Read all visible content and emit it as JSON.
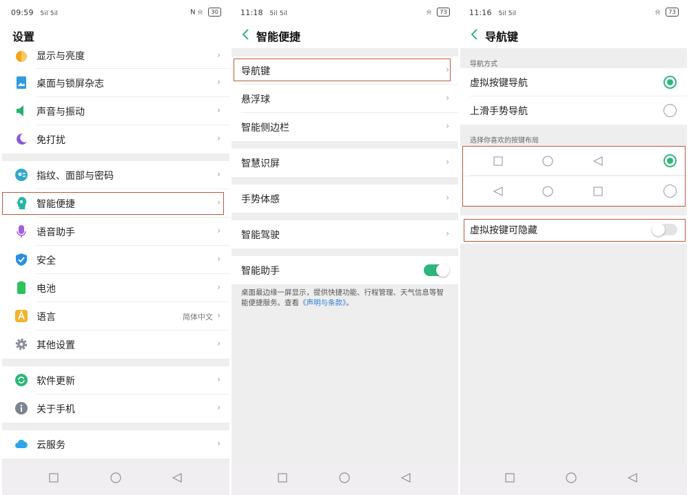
{
  "colors": {
    "accent": "#2eb67d",
    "highlight": "#c0553c",
    "link": "#2b7fd6"
  },
  "panel1": {
    "status": {
      "time": "09:59",
      "signal": "5il 5il",
      "right_icons": "N ⍾",
      "battery": "30"
    },
    "title": "设置",
    "items": [
      {
        "label": "显示与亮度",
        "icon": "brightness-icon"
      },
      {
        "label": "桌面与锁屏杂志",
        "icon": "wallpaper-icon"
      },
      {
        "label": "声音与振动",
        "icon": "sound-icon"
      },
      {
        "label": "免打扰",
        "icon": "moon-icon"
      },
      {
        "label": "指纹、面部与密码",
        "icon": "fingerprint-icon"
      },
      {
        "label": "智能便捷",
        "icon": "smart-assist-icon"
      },
      {
        "label": "语音助手",
        "icon": "microphone-icon"
      },
      {
        "label": "安全",
        "icon": "shield-icon"
      },
      {
        "label": "电池",
        "icon": "battery-icon"
      },
      {
        "label": "语言",
        "icon": "language-icon",
        "value": "简体中文"
      },
      {
        "label": "其他设置",
        "icon": "gear-icon"
      },
      {
        "label": "软件更新",
        "icon": "update-icon"
      },
      {
        "label": "关于手机",
        "icon": "info-icon"
      },
      {
        "label": "云服务",
        "icon": "cloud-icon"
      }
    ]
  },
  "panel2": {
    "status": {
      "time": "11:18",
      "signal": "5il 5il",
      "battery": "73"
    },
    "title": "智能便捷",
    "items": [
      {
        "label": "导航键"
      },
      {
        "label": "悬浮球"
      },
      {
        "label": "智能侧边栏"
      },
      {
        "label": "智慧识屏"
      },
      {
        "label": "手势体感"
      },
      {
        "label": "智能驾驶"
      },
      {
        "label": "智能助手",
        "toggle": "on"
      }
    ],
    "footnote_text": "桌面最边缘一屏显示，提供快捷功能、行程管理、天气信息等智能便捷服务。查看",
    "footnote_link": "《声明与条款》",
    "footnote_end": "。"
  },
  "panel3": {
    "status": {
      "time": "11:16",
      "signal": "5il 5il",
      "battery": "73"
    },
    "title": "导航键",
    "section_nav_mode": "导航方式",
    "nav_modes": [
      {
        "label": "虚拟按键导航",
        "selected": true
      },
      {
        "label": "上滑手势导航",
        "selected": false
      }
    ],
    "section_layout": "选择你喜欢的按键布局",
    "layouts": [
      {
        "buttons": [
          "square-icon",
          "circle-icon",
          "triangle-left-icon"
        ],
        "selected": true
      },
      {
        "buttons": [
          "triangle-left-icon",
          "circle-icon",
          "square-icon"
        ],
        "selected": false
      }
    ],
    "hide_keys": {
      "label": "虚拟按键可隐藏",
      "toggle": "off"
    }
  }
}
